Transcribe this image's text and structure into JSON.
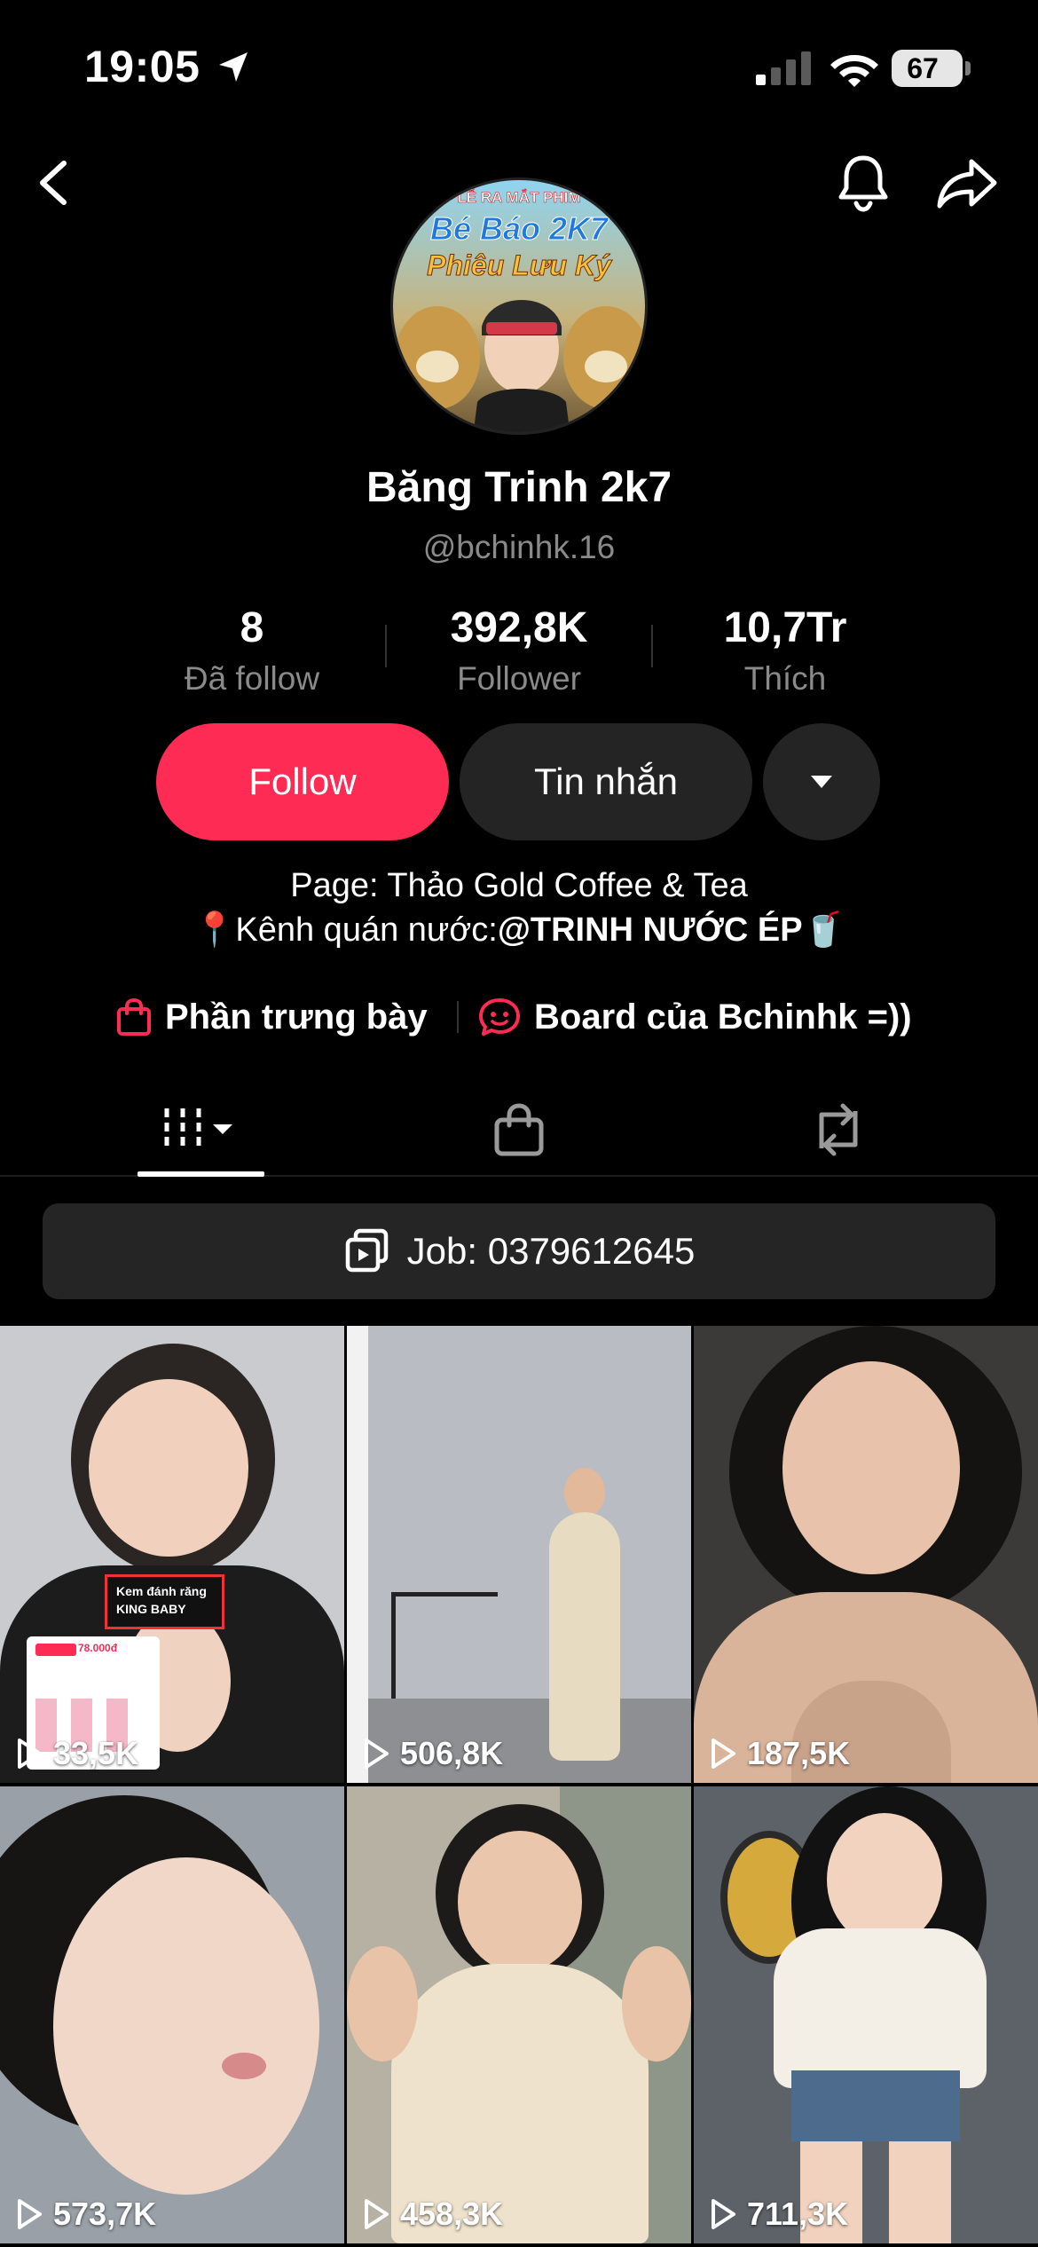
{
  "status_bar": {
    "time": "19:05",
    "battery": "67",
    "icons": [
      "location-arrow-icon",
      "cellular-signal-icon",
      "wifi-icon",
      "battery-icon"
    ]
  },
  "nav": {
    "icons": [
      "back-chevron-icon",
      "notification-bell-icon",
      "share-arrow-icon"
    ]
  },
  "avatar": {
    "line1": "LỄ RA MẮT PHIM",
    "line2": "Bé Báo 2K7",
    "line3": "Phiêu Lưu Ký"
  },
  "profile": {
    "display_name": "Băng Trinh 2k7",
    "username": "@bchinhk.16"
  },
  "stats": [
    {
      "value": "8",
      "label": "Đã follow"
    },
    {
      "value": "392,8K",
      "label": "Follower"
    },
    {
      "value": "10,7Tr",
      "label": "Thích"
    }
  ],
  "actions": {
    "follow": "Follow",
    "message": "Tin nhắn"
  },
  "bio": {
    "line1": "Page: Thảo Gold Coffee & Tea",
    "line2_prefix": "📍Kênh quán nước:",
    "line2_mention": "@TRINH NƯỚC ÉP",
    "line2_suffix": "🥤"
  },
  "links": {
    "showcase": "Phần trưng bày",
    "board": "Board của Bchinhk =))"
  },
  "tabs": {
    "icons": [
      "videos-grid-icon",
      "shop-bag-icon",
      "repost-icon"
    ],
    "active": "videos-grid-icon"
  },
  "pinned": {
    "label": "Job: 0379612645"
  },
  "videos": [
    {
      "views": "33,5K",
      "overlay_tag": "Kem đánh răng KING BABY",
      "overlay_price": "78.000đ"
    },
    {
      "views": "506,8K"
    },
    {
      "views": "187,5K"
    },
    {
      "views": "573,7K"
    },
    {
      "views": "458,3K"
    },
    {
      "views": "711,3K"
    }
  ],
  "colors": {
    "accent": "#fe2c55",
    "background": "#000000",
    "muted_text": "#8a8a8a",
    "button_dark": "#242424"
  }
}
